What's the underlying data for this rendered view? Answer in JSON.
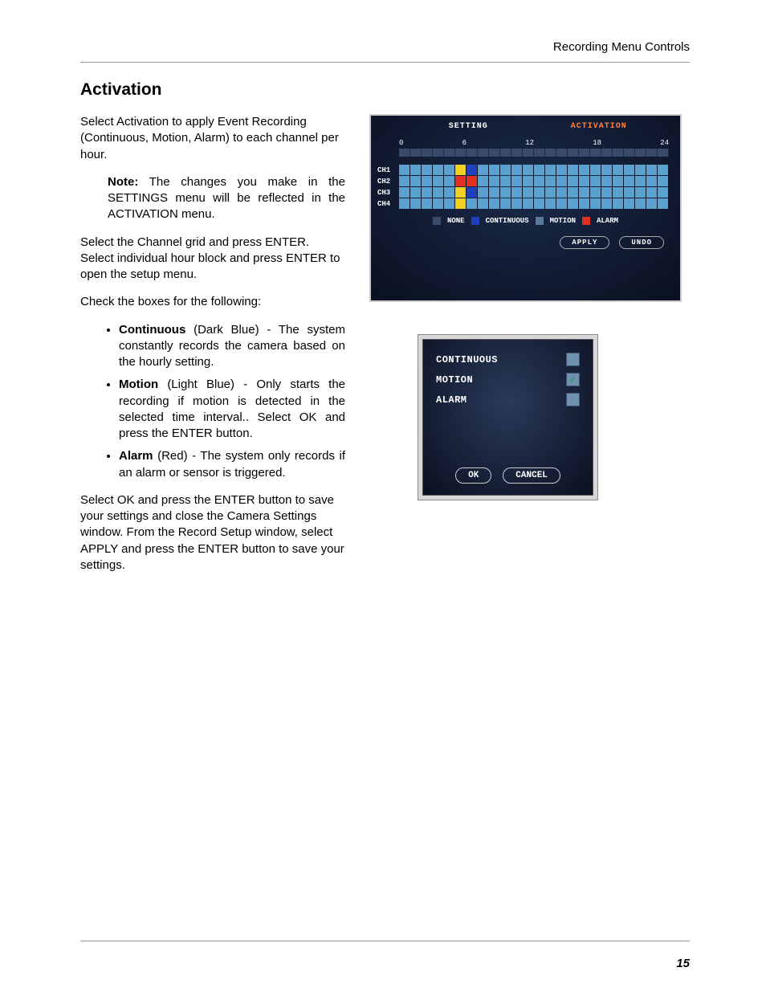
{
  "header": "Recording Menu Controls",
  "title": "Activation",
  "page_number": "15",
  "body": {
    "p1": "Select Activation to apply Event Recording (Continuous, Motion, Alarm) to each channel per hour.",
    "note_label": "Note:",
    "note_text": " The changes you make in the SETTINGS menu will be reflected in the ACTIVATION menu.",
    "p2": "Select the Channel grid and press ENTER. Select individual hour block and press ENTER to open the setup menu.",
    "p3": "Check the boxes for the following:",
    "bullets": [
      {
        "label": "Continuous",
        "text": " (Dark Blue) - The system constantly records the camera based on the hourly setting."
      },
      {
        "label": "Motion",
        "text": " (Light Blue) - Only starts the recording if motion is detected in the selected time interval.. Select OK and press the ENTER button."
      },
      {
        "label": "Alarm",
        "text": " (Red) - The system only records if an alarm or sensor is triggered."
      }
    ],
    "p4": "Select OK and press the ENTER button to save your settings and close the Camera Settings window. From the Record Setup window, select APPLY and press the ENTER button to save your settings."
  },
  "screenshot1": {
    "tabs": {
      "setting": "SETTING",
      "activation": "ACTIVATION"
    },
    "timescale": [
      "0",
      "6",
      "12",
      "18",
      "24"
    ],
    "channels": [
      "CH1",
      "CH2",
      "CH3",
      "CH4"
    ],
    "legend": {
      "none": "NONE",
      "continuous": "CONTINUOUS",
      "motion": "MOTION",
      "alarm": "ALARM"
    },
    "buttons": {
      "apply": "APPLY",
      "undo": "UNDO"
    }
  },
  "screenshot2": {
    "options": [
      {
        "label": "CONTINUOUS",
        "checked": false
      },
      {
        "label": "MOTION",
        "checked": true
      },
      {
        "label": "ALARM",
        "checked": false
      }
    ],
    "buttons": {
      "ok": "OK",
      "cancel": "CANCEL"
    }
  }
}
